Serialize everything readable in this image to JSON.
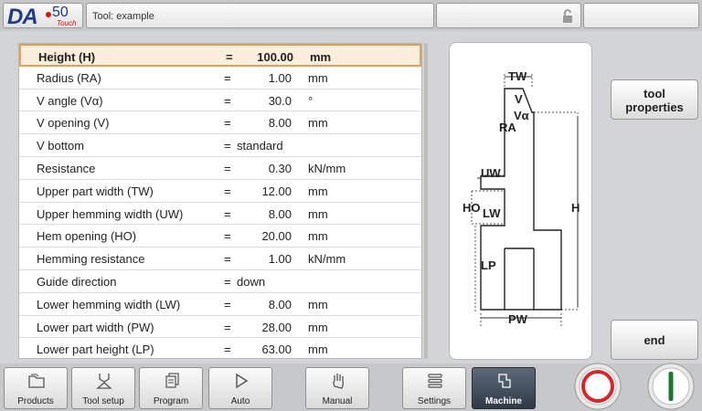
{
  "header": {
    "logo": {
      "brand": "DA",
      "model": "50",
      "edition": "Touch"
    },
    "title": "Tool: example"
  },
  "parameters": [
    {
      "label": "Height (H)",
      "eq": "=",
      "value": "100.00",
      "unit": "mm",
      "selected": true
    },
    {
      "label": "Radius (RA)",
      "eq": "=",
      "value": "1.00",
      "unit": "mm"
    },
    {
      "label": "V angle (Vα)",
      "eq": "=",
      "value": "30.0",
      "unit": "°"
    },
    {
      "label": "V opening (V)",
      "eq": "=",
      "value": "8.00",
      "unit": "mm"
    },
    {
      "label": "V bottom",
      "eq": "=",
      "text": "standard"
    },
    {
      "label": "Resistance",
      "eq": "=",
      "value": "0.30",
      "unit": "kN/mm"
    },
    {
      "label": "Upper part width (TW)",
      "eq": "=",
      "value": "12.00",
      "unit": "mm"
    },
    {
      "label": "Upper hemming width (UW)",
      "eq": "=",
      "value": "8.00",
      "unit": "mm"
    },
    {
      "label": "Hem opening (HO)",
      "eq": "=",
      "value": "20.00",
      "unit": "mm"
    },
    {
      "label": "Hemming resistance",
      "eq": "=",
      "value": "1.00",
      "unit": "kN/mm"
    },
    {
      "label": "Guide direction",
      "eq": "=",
      "text": "down"
    },
    {
      "label": "Lower hemming width (LW)",
      "eq": "=",
      "value": "8.00",
      "unit": "mm"
    },
    {
      "label": "Lower part width (PW)",
      "eq": "=",
      "value": "28.00",
      "unit": "mm"
    },
    {
      "label": "Lower part height (LP)",
      "eq": "=",
      "value": "63.00",
      "unit": "mm"
    }
  ],
  "diagram": {
    "labels": {
      "TW": "TW",
      "V": "V",
      "Va": "Vα",
      "RA": "RA",
      "UW": "UW",
      "HO": "HO",
      "LW": "LW",
      "H": "H",
      "LP": "LP",
      "PW": "PW"
    }
  },
  "side_buttons": {
    "tool_properties": [
      "tool",
      "properties"
    ],
    "end": "end"
  },
  "nav": [
    {
      "label": "Products",
      "icon": "folder-icon"
    },
    {
      "label": "Tool setup",
      "icon": "tool-icon"
    },
    {
      "label": "Program",
      "icon": "pages-icon"
    },
    {
      "label": "Auto",
      "icon": "play-icon"
    },
    {
      "label": "Manual",
      "icon": "hand-icon"
    },
    {
      "label": "Settings",
      "icon": "list-icon"
    },
    {
      "label": "Machine",
      "icon": "machine-icon",
      "active": true
    }
  ],
  "controls": {
    "stop": "stop-icon",
    "start": "start-icon"
  },
  "colors": {
    "accent_border": "#e0a25a",
    "selected_row": "#fbeedc",
    "stop_red": "#d8262b",
    "start_green": "#1a7a2c"
  }
}
